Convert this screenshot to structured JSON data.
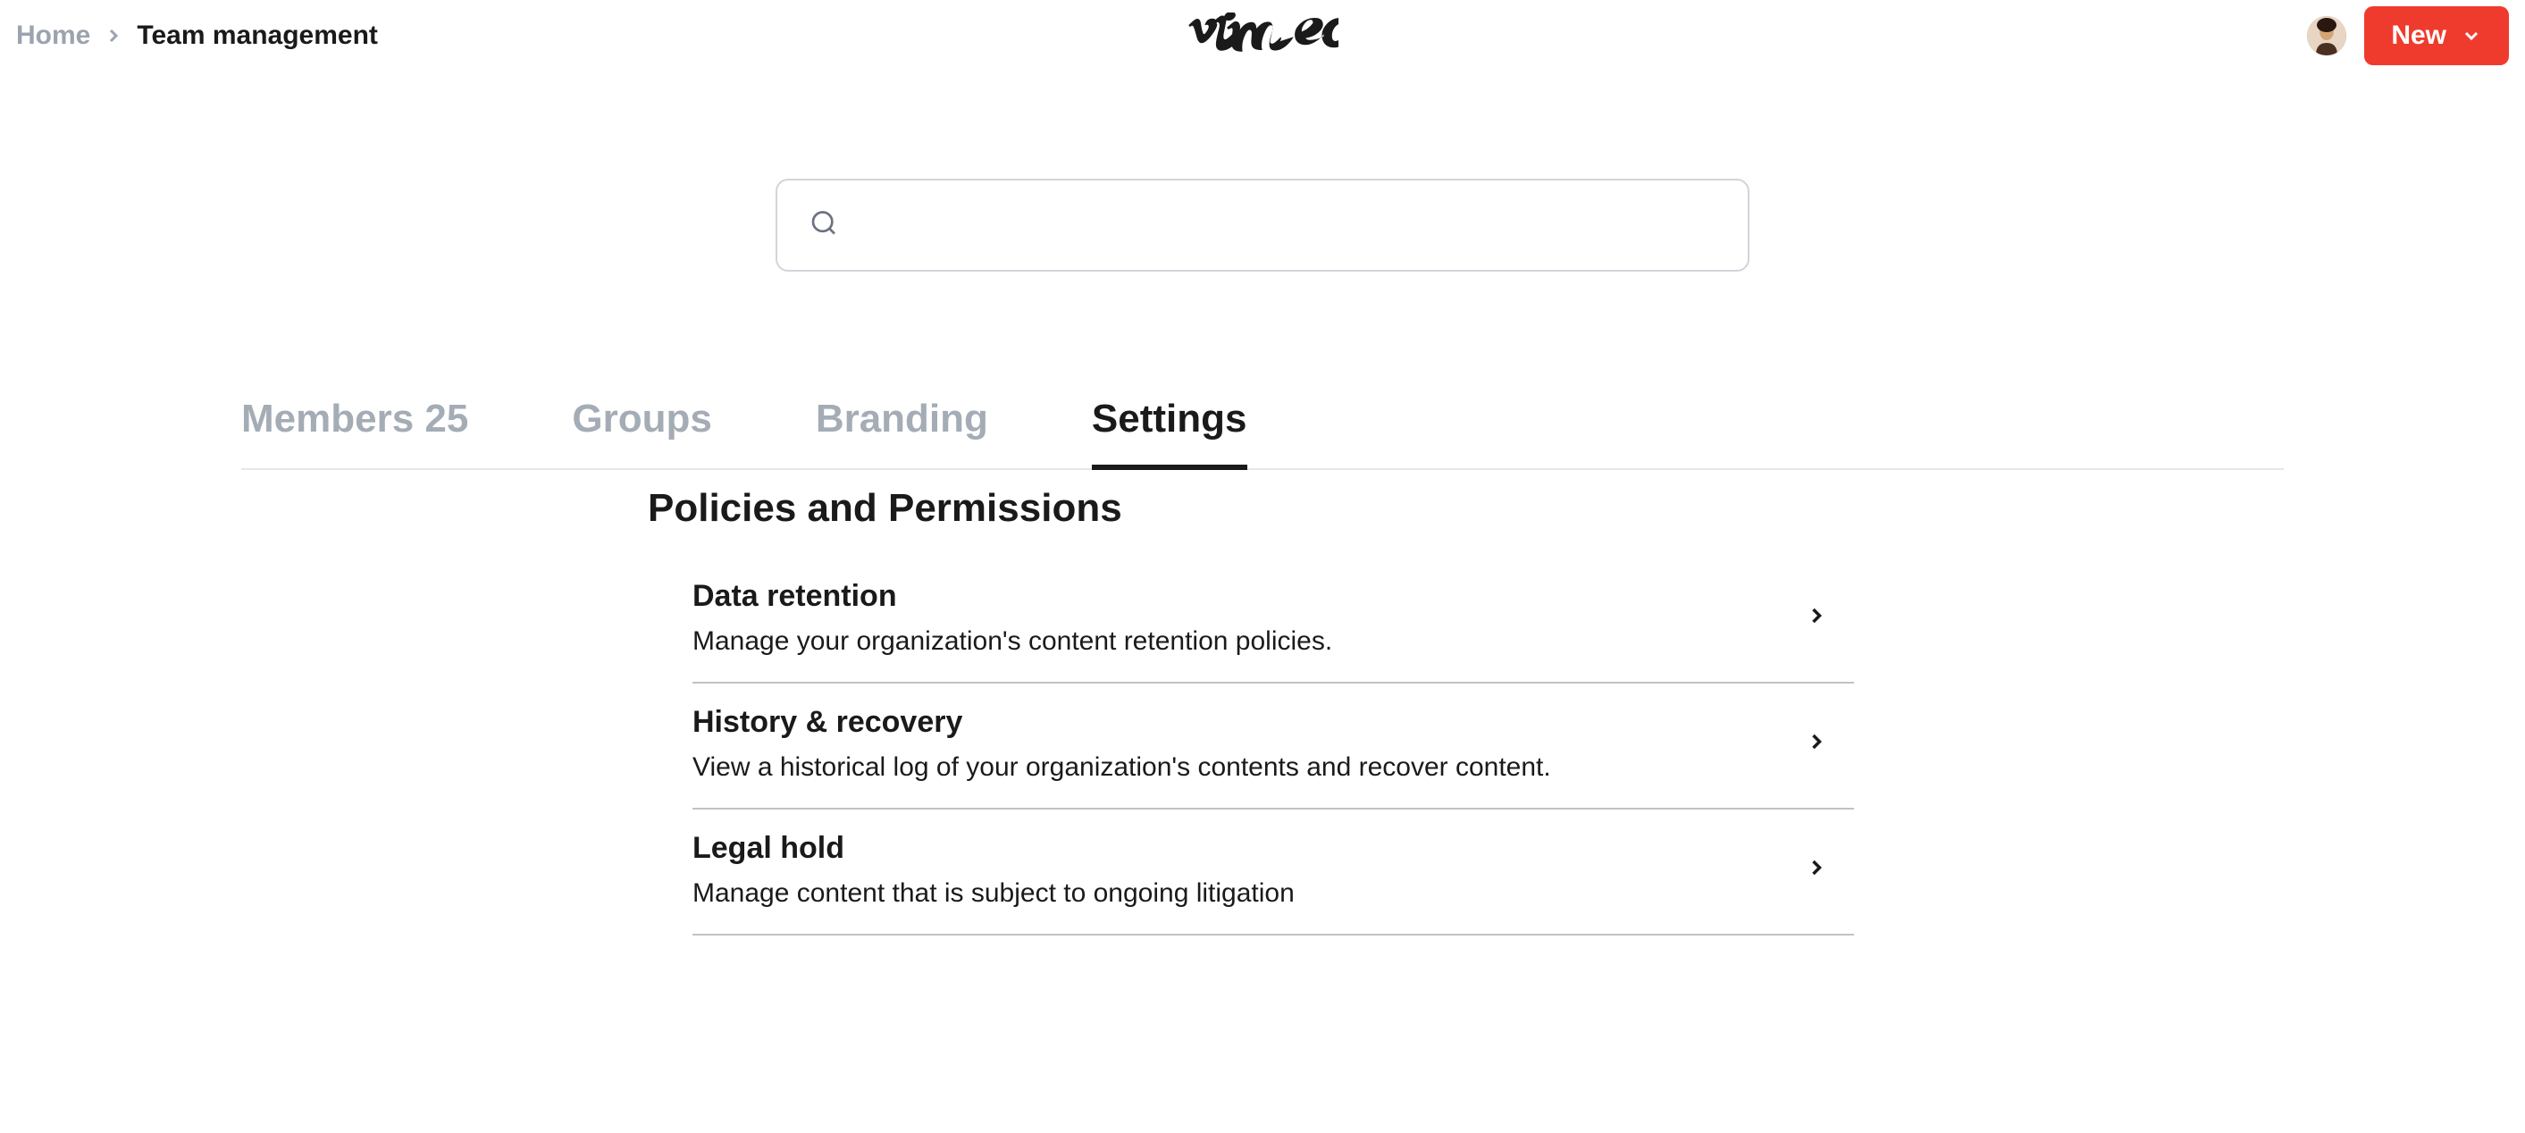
{
  "breadcrumb": {
    "home": "Home",
    "current": "Team management"
  },
  "header": {
    "new_button": "New"
  },
  "search": {
    "placeholder": ""
  },
  "tabs": [
    {
      "label": "Members 25",
      "active": false
    },
    {
      "label": "Groups",
      "active": false
    },
    {
      "label": "Branding",
      "active": false
    },
    {
      "label": "Settings",
      "active": true
    }
  ],
  "section": {
    "title": "Policies and Permissions"
  },
  "items": [
    {
      "title": "Data retention",
      "description": "Manage your organization's content retention policies."
    },
    {
      "title": "History & recovery",
      "description": "View a historical log of your organization's contents and recover content."
    },
    {
      "title": "Legal hold",
      "description": "Manage content that is subject to ongoing litigation"
    }
  ]
}
